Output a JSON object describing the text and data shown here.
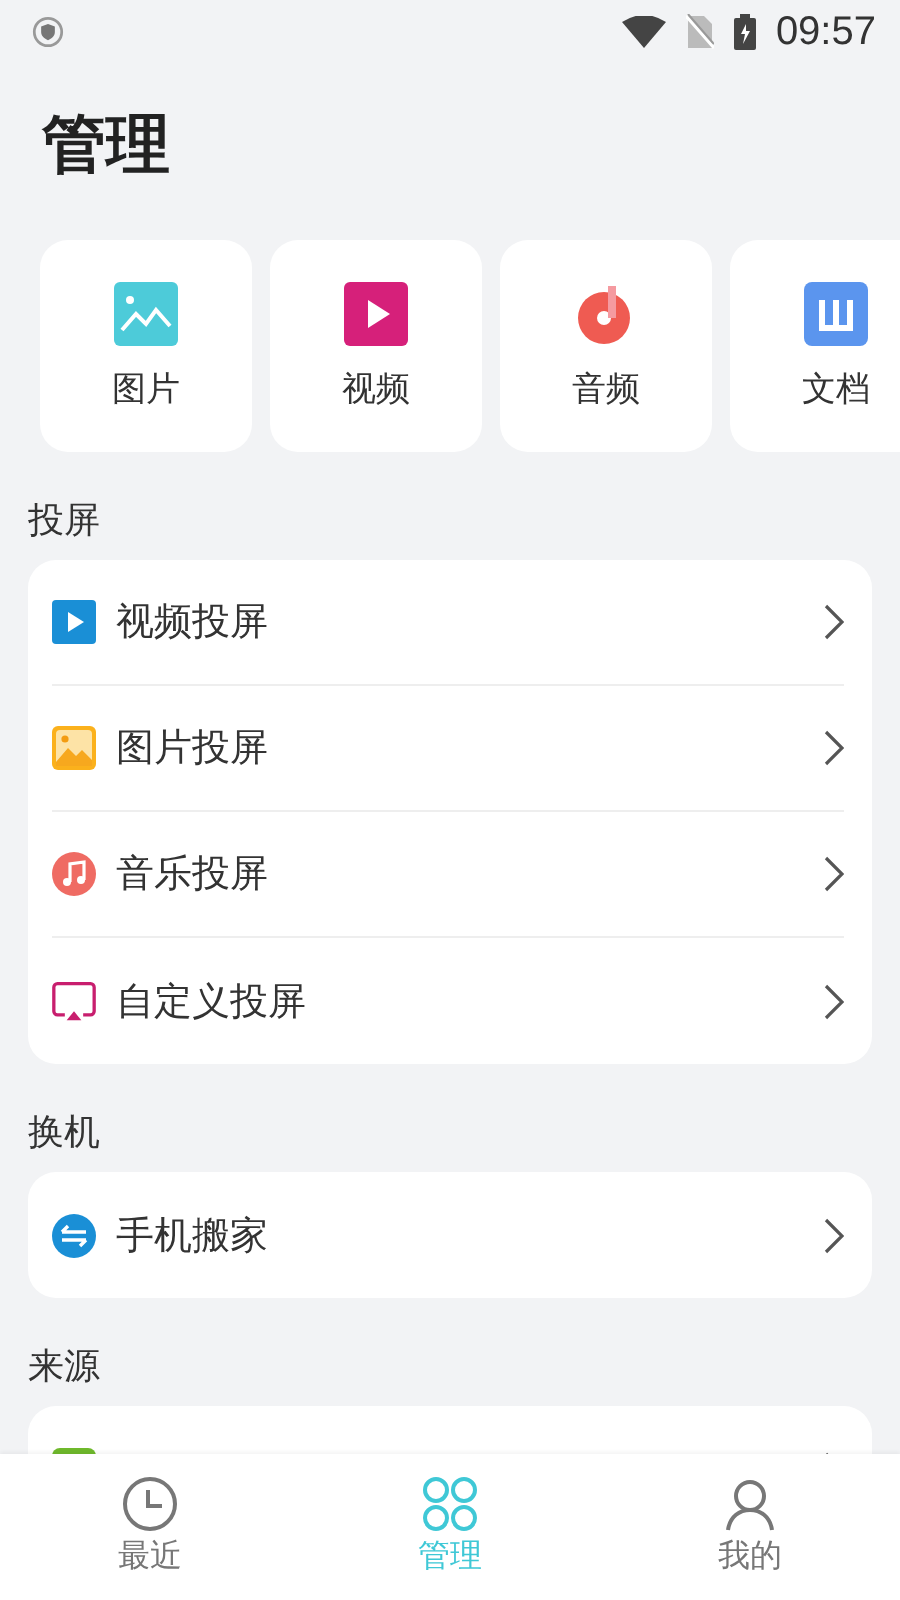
{
  "status_bar": {
    "time": "09:57"
  },
  "title": "管理",
  "categories": [
    {
      "label": "图片",
      "kind": "image"
    },
    {
      "label": "视频",
      "kind": "video"
    },
    {
      "label": "音频",
      "kind": "audio"
    },
    {
      "label": "文档",
      "kind": "doc"
    }
  ],
  "sections": [
    {
      "heading": "投屏",
      "items": [
        {
          "label": "视频投屏",
          "kind": "video"
        },
        {
          "label": "图片投屏",
          "kind": "image"
        },
        {
          "label": "音乐投屏",
          "kind": "music"
        },
        {
          "label": "自定义投屏",
          "kind": "cast"
        }
      ]
    },
    {
      "heading": "换机",
      "items": [
        {
          "label": "手机搬家",
          "kind": "transfer"
        }
      ]
    },
    {
      "heading": "来源",
      "items": [
        {
          "kind": "source"
        }
      ]
    }
  ],
  "tabs": [
    {
      "label": "最近",
      "kind": "clock",
      "selected": false
    },
    {
      "label": "管理",
      "kind": "grid",
      "selected": true
    },
    {
      "label": "我的",
      "kind": "person",
      "selected": false
    }
  ]
}
